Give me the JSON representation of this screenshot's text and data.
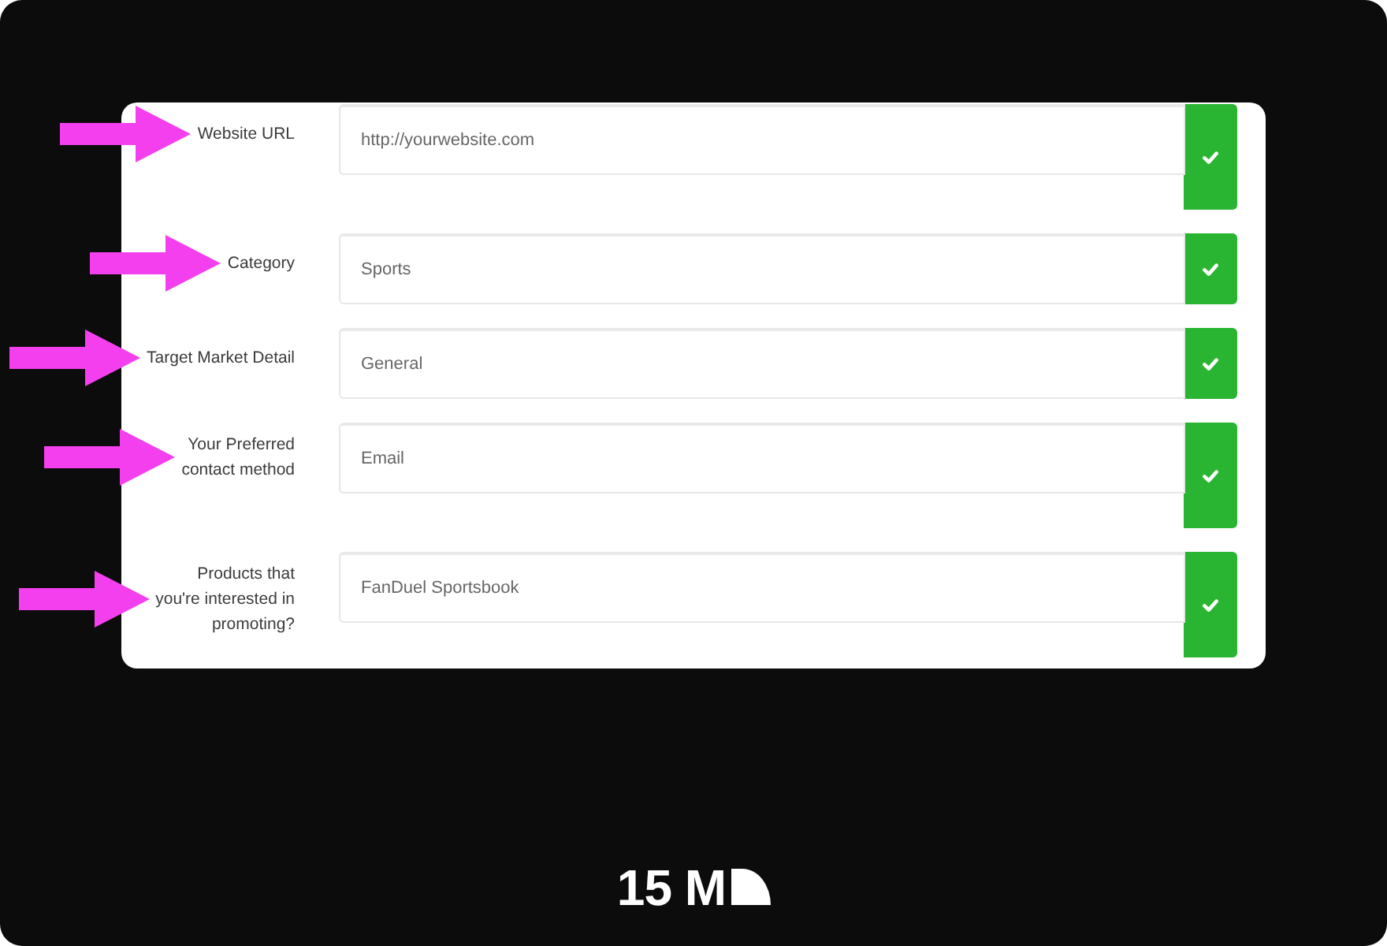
{
  "form": {
    "fields": [
      {
        "label": "Website URL",
        "placeholder": "http://yourwebsite.com",
        "valid": true
      },
      {
        "label": "Category",
        "value": "Sports",
        "valid": true
      },
      {
        "label": "Target Market Detail",
        "value": "General",
        "valid": true
      },
      {
        "label": "Your Preferred\ncontact method",
        "value": "Email",
        "valid": true
      },
      {
        "label": "Products that\nyou're interested in\npromoting?",
        "value": "FanDuel Sportsbook",
        "valid": true
      }
    ]
  },
  "logo": {
    "text": "15 M"
  }
}
